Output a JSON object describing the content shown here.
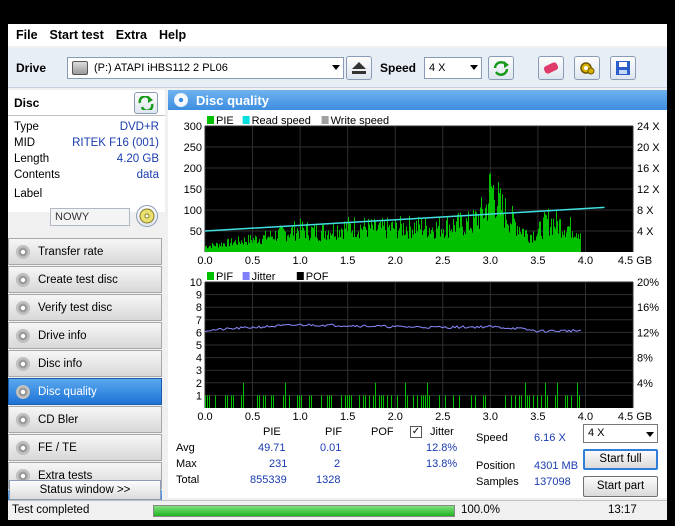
{
  "menu": [
    "File",
    "Start test",
    "Extra",
    "Help"
  ],
  "toolbar": {
    "drive_label": "Drive",
    "drive_value": "(P:)  ATAPI iHBS112  2 PL06",
    "speed_label": "Speed",
    "speed_value": "4 X"
  },
  "disc": {
    "title": "Disc",
    "rows": [
      {
        "k": "Type",
        "v": "DVD+R"
      },
      {
        "k": "MID",
        "v": "RITEK F16 (001)"
      },
      {
        "k": "Length",
        "v": "4.20 GB"
      },
      {
        "k": "Contents",
        "v": "data"
      }
    ],
    "label_key": "Label",
    "label_value": "NOWY"
  },
  "nav": [
    "Transfer rate",
    "Create test disc",
    "Verify test disc",
    "Drive info",
    "Disc info",
    "Disc quality",
    "CD Bler",
    "FE / TE",
    "Extra tests"
  ],
  "nav_active": "Disc quality",
  "status_window": "Status window >>",
  "main_title": "Disc quality",
  "chart_data": [
    {
      "type": "area",
      "legend": [
        "PIE",
        "Read speed",
        "Write speed"
      ],
      "legend_colors": [
        "#00c000",
        "#00e0e0",
        "#a0a0a0"
      ],
      "xlim": [
        0,
        4.5
      ],
      "x_ticks": [
        "0.0",
        "0.5",
        "1.0",
        "1.5",
        "2.0",
        "2.5",
        "3.0",
        "3.5",
        "4.0",
        "4.5 GB"
      ],
      "ylim": [
        0,
        300
      ],
      "y_ticks": [
        "300",
        "250",
        "200",
        "150",
        "100",
        "50"
      ],
      "y2_ticks": [
        "24 X",
        "20 X",
        "16 X",
        "12 X",
        "8 X",
        "4 X"
      ],
      "y2lim": [
        0,
        24
      ],
      "pie_envelope": {
        "x": [
          0,
          0.2,
          0.4,
          0.6,
          0.8,
          1.0,
          1.2,
          1.4,
          1.6,
          1.8,
          2.0,
          2.2,
          2.4,
          2.6,
          2.8,
          2.95,
          3.0,
          3.05,
          3.1,
          3.2,
          3.3,
          3.4,
          3.5,
          3.6,
          3.7,
          3.8,
          3.9,
          4.0,
          4.1,
          4.2
        ],
        "y": [
          20,
          30,
          40,
          50,
          65,
          80,
          70,
          85,
          90,
          80,
          85,
          90,
          85,
          95,
          100,
          150,
          231,
          200,
          160,
          120,
          90,
          60,
          70,
          110,
          100,
          90,
          80,
          60,
          100,
          50
        ]
      },
      "read_speed": {
        "x": [
          0,
          4.2
        ],
        "y": [
          4.0,
          8.5
        ]
      }
    },
    {
      "type": "bar",
      "legend": [
        "PIF",
        "Jitter",
        "POF"
      ],
      "legend_colors": [
        "#00c000",
        "#8080ff",
        "#000000"
      ],
      "xlim": [
        0,
        4.5
      ],
      "x_ticks": [
        "0.0",
        "0.5",
        "1.0",
        "1.5",
        "2.0",
        "2.5",
        "3.0",
        "3.5",
        "4.0",
        "4.5 GB"
      ],
      "ylim": [
        0,
        10
      ],
      "y_ticks": [
        "10",
        "9",
        "8",
        "7",
        "6",
        "5",
        "4",
        "3",
        "2",
        "1"
      ],
      "y2_ticks": [
        "20%",
        "16%",
        "12%",
        "8%",
        "4%"
      ],
      "y2lim": [
        0,
        20
      ],
      "jitter": {
        "x": [
          0,
          0.5,
          1.0,
          1.5,
          2.0,
          2.5,
          3.0,
          3.3,
          3.5,
          4.0,
          4.2
        ],
        "y": [
          12.3,
          12.8,
          13.2,
          13.1,
          12.9,
          12.8,
          12.9,
          12.6,
          12.2,
          12.3,
          12.1
        ]
      }
    }
  ],
  "stats": {
    "headers": {
      "pie": "PIE",
      "pif": "PIF",
      "pof": "POF",
      "jitter": "Jitter"
    },
    "jitter_checked": "✓",
    "rows": [
      {
        "label": "Avg",
        "pie": "49.71",
        "pif": "0.01",
        "jitter": "12.8%"
      },
      {
        "label": "Max",
        "pie": "231",
        "pif": "2",
        "jitter": "13.8%"
      },
      {
        "label": "Total",
        "pie": "855339",
        "pif": "1328",
        "jitter": ""
      }
    ],
    "speed_label": "Speed",
    "speed_value": "6.16 X",
    "position_label": "Position",
    "position_value": "4301 MB",
    "samples_label": "Samples",
    "samples_value": "137098",
    "speed_select": "4 X",
    "start_full": "Start full",
    "start_part": "Start part"
  },
  "statusbar": {
    "text": "Test completed",
    "percent": "100.0%",
    "progress": 1.0,
    "time": "13:17"
  }
}
